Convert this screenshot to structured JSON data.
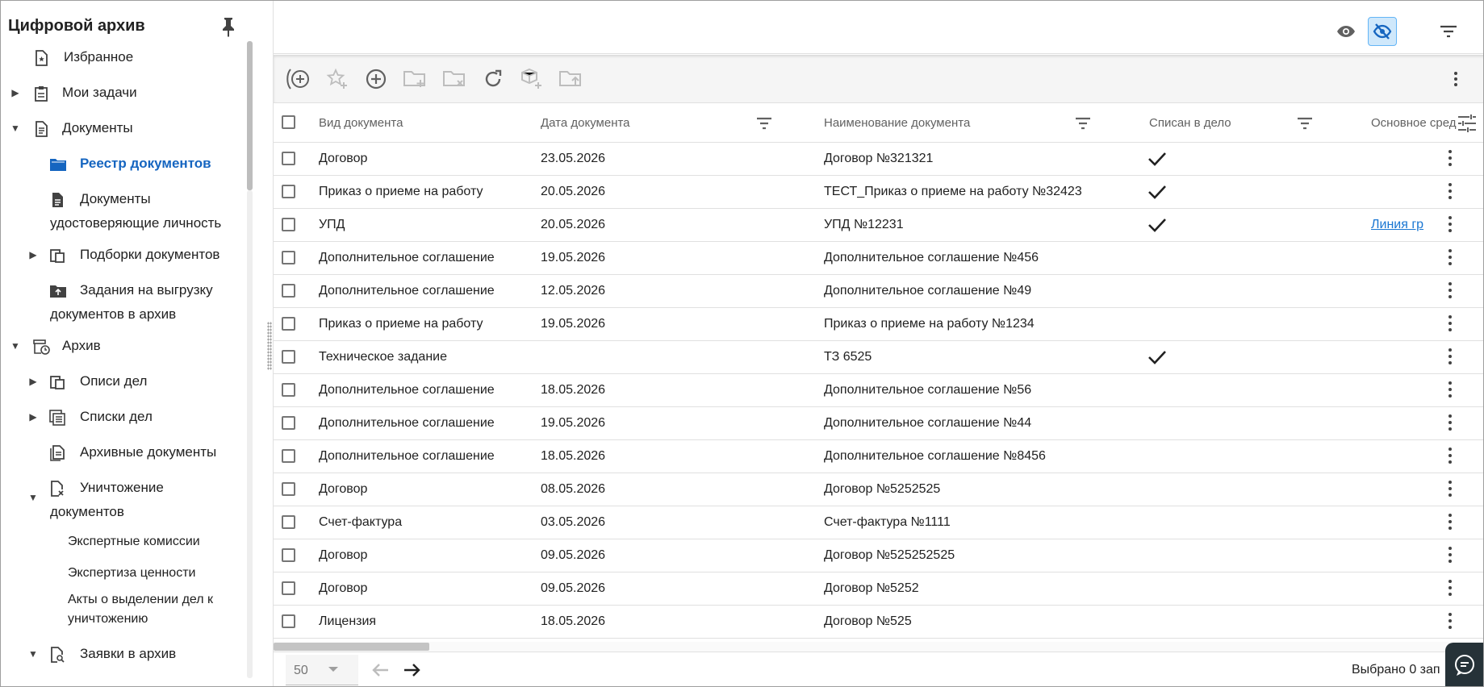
{
  "sidebar": {
    "title": "Цифровой архив",
    "items": [
      {
        "label": "Избранное"
      },
      {
        "label": "Мои задачи"
      },
      {
        "label": "Документы"
      },
      {
        "label": "Реестр документов"
      },
      {
        "label": "Документы",
        "label2": "удостоверяющие личность"
      },
      {
        "label": "Подборки документов"
      },
      {
        "label": "Задания на выгрузку",
        "label2": "документов в архив"
      },
      {
        "label": "Архив"
      },
      {
        "label": "Описи дел"
      },
      {
        "label": "Списки дел"
      },
      {
        "label": "Архивные документы"
      },
      {
        "label": "Уничтожение",
        "label2": "документов"
      },
      {
        "label": "Экспертные комиссии"
      },
      {
        "label": "Экспертиза ценности"
      },
      {
        "label": "Акты о выделении дел к",
        "label2": "уничтожению"
      },
      {
        "label": "Заявки в архив"
      }
    ]
  },
  "table": {
    "columns": [
      "Вид документа",
      "Дата документа",
      "Наименование документа",
      "Списан в дело",
      "Основное сред"
    ],
    "rows": [
      {
        "type": "Договор",
        "date": "23.05.2026",
        "name": "Договор №321321",
        "filed": true,
        "asset": ""
      },
      {
        "type": "Приказ о приеме на работу",
        "date": "20.05.2026",
        "name": "ТЕСТ_Приказ о приеме на работу №32423",
        "filed": true,
        "asset": ""
      },
      {
        "type": "УПД",
        "date": "20.05.2026",
        "name": "УПД №12231",
        "filed": true,
        "asset": "Линия гр"
      },
      {
        "type": "Дополнительное соглашение",
        "date": "19.05.2026",
        "name": "Дополнительное соглашение №456",
        "filed": false,
        "asset": ""
      },
      {
        "type": "Дополнительное соглашение",
        "date": "12.05.2026",
        "name": "Дополнительное соглашение №49",
        "filed": false,
        "asset": ""
      },
      {
        "type": "Приказ о приеме на работу",
        "date": "19.05.2026",
        "name": "Приказ о приеме на работу №1234",
        "filed": false,
        "asset": ""
      },
      {
        "type": "Техническое задание",
        "date": "",
        "name": "ТЗ 6525",
        "filed": true,
        "asset": ""
      },
      {
        "type": "Дополнительное соглашение",
        "date": "18.05.2026",
        "name": "Дополнительное соглашение №56",
        "filed": false,
        "asset": ""
      },
      {
        "type": "Дополнительное соглашение",
        "date": "19.05.2026",
        "name": "Дополнительное соглашение №44",
        "filed": false,
        "asset": ""
      },
      {
        "type": "Дополнительное соглашение",
        "date": "18.05.2026",
        "name": "Дополнительное соглашение №8456",
        "filed": false,
        "asset": ""
      },
      {
        "type": "Договор",
        "date": "08.05.2026",
        "name": "Договор №5252525",
        "filed": false,
        "asset": ""
      },
      {
        "type": "Счет-фактура",
        "date": "03.05.2026",
        "name": "Счет-фактура №1111",
        "filed": false,
        "asset": ""
      },
      {
        "type": "Договор",
        "date": "09.05.2026",
        "name": "Договор №525252525",
        "filed": false,
        "asset": ""
      },
      {
        "type": "Договор",
        "date": "09.05.2026",
        "name": "Договор №5252",
        "filed": false,
        "asset": ""
      },
      {
        "type": "Лицензия",
        "date": "18.05.2026",
        "name": "Договор №525",
        "filed": false,
        "asset": ""
      }
    ]
  },
  "footer": {
    "page_size": "50",
    "selected_info": "Выбрано 0 зап"
  },
  "colors": {
    "accent": "#1565c0",
    "link": "#1976d2",
    "active_icon_bg": "#cfe8fb"
  }
}
